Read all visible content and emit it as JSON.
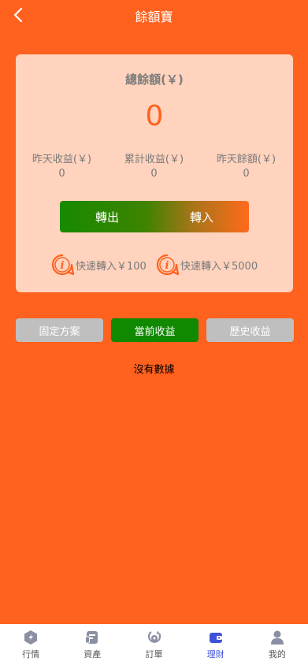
{
  "header": {
    "title": "餘額寶"
  },
  "balance": {
    "total_label": "總餘額(￥)",
    "total_value": "0",
    "stats": [
      {
        "label": "昨天收益(￥)",
        "value": "0"
      },
      {
        "label": "累計收益(￥)",
        "value": "0"
      },
      {
        "label": "昨天餘額(￥)",
        "value": "0"
      }
    ],
    "transfer_out": "轉出",
    "transfer_in": "轉入",
    "quick": [
      {
        "label": "快速轉入￥100"
      },
      {
        "label": "快速轉入￥5000"
      }
    ]
  },
  "filters": [
    {
      "label": "固定方案",
      "active": false
    },
    {
      "label": "當前收益",
      "active": true
    },
    {
      "label": "歷史收益",
      "active": false
    }
  ],
  "empty_text": "沒有數據",
  "tabbar": [
    {
      "label": "行情",
      "icon": "market-icon"
    },
    {
      "label": "資產",
      "icon": "assets-icon"
    },
    {
      "label": "訂單",
      "icon": "orders-icon"
    },
    {
      "label": "理財",
      "icon": "wallet-icon",
      "active": true
    },
    {
      "label": "我的",
      "icon": "profile-icon"
    }
  ],
  "colors": {
    "background": "#ff611e",
    "card": "#ffd3bd",
    "green": "#0f8900",
    "gray_button": "#c0bfbf",
    "active_tab": "#3e52d9"
  }
}
